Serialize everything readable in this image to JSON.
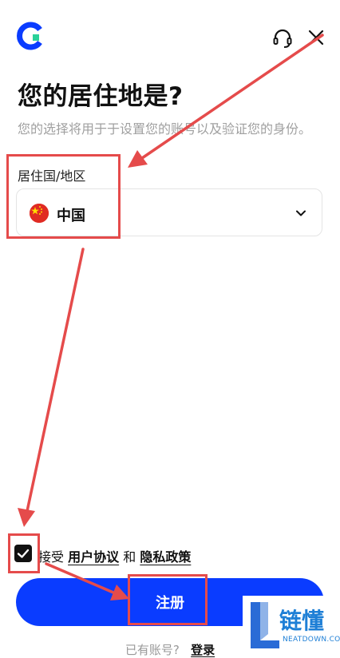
{
  "header": {
    "logo_icon": "exchange-logo-icon",
    "support_icon": "headset-icon",
    "close_icon": "close-icon"
  },
  "page": {
    "title": "您的居住地是?",
    "subtitle": "您的选择将用于于设置您的账号以及验证您的身份。"
  },
  "residence": {
    "label": "居住国/地区",
    "selected_country": "中国",
    "flag_icon": "china-flag-icon"
  },
  "agreement": {
    "checked": true,
    "prefix": "接受",
    "terms_link": "用户协议",
    "joiner": "和",
    "privacy_link": "隐私政策"
  },
  "register_button": "注册",
  "login_prompt": {
    "text": "已有账号?",
    "link": "登录"
  },
  "watermark": {
    "cn": "链懂",
    "en": "NEATDOWN.COM"
  },
  "colors": {
    "primary": "#0a3cff",
    "annotation": "#e54b4b",
    "flag_red": "#e02b23",
    "flag_star": "#ffde00"
  }
}
